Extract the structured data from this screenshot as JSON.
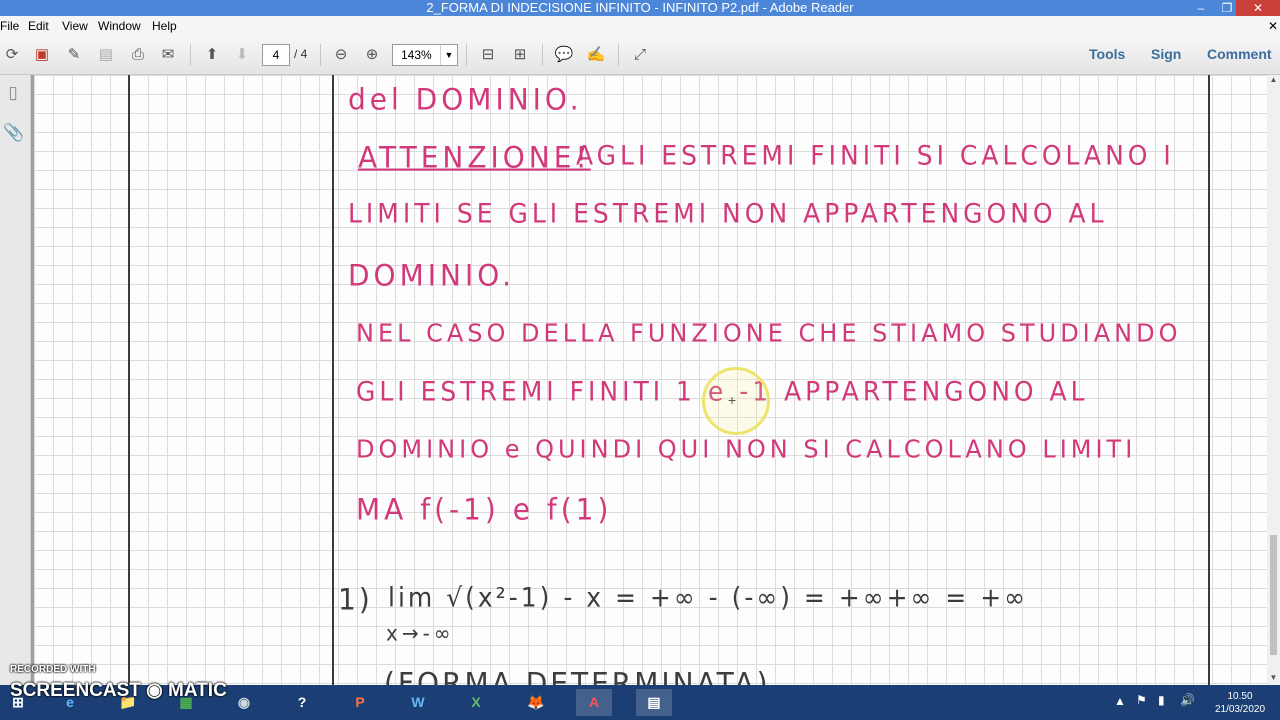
{
  "window": {
    "title": "2_FORMA DI INDECISIONE INFINITO - INFINITO P2.pdf - Adobe Reader",
    "minimize": "–",
    "restore": "❐",
    "close": "✕"
  },
  "menu": {
    "items": [
      "File",
      "Edit",
      "View",
      "Window",
      "Help"
    ],
    "close_doc": "✕"
  },
  "toolbar": {
    "page_current": "4",
    "page_total": "/ 4",
    "zoom": "143%",
    "tools_label": "Tools",
    "sign_label": "Sign",
    "comment_label": "Comment"
  },
  "document": {
    "lines": [
      "del DOMINIO.",
      "ATTENZIONE!",
      "AGLI ESTREMI FINITI SI CALCOLANO I",
      "LIMITI SE GLI ESTREMI NON APPARTENGONO AL",
      "DOMINIO.",
      "NEL CASO DELLA FUNZIONE CHE STIAMO STUDIANDO",
      "GLI ESTREMI FINITI  1 e -1  APPARTENGONO AL",
      "DOMINIO e QUINDI QUI NON SI CALCOLANO LIMITI",
      "MA  f(-1)  e  f(1)"
    ],
    "math": {
      "number": "1)",
      "expr": "lim  √(x²-1) - x  =  +∞ - (-∞) = +∞+∞ = +∞",
      "subscript": "x→-∞",
      "next_line": "(FORMA DETERMINATA)"
    }
  },
  "taskbar": {
    "apps": [
      "⊞",
      "e",
      "📁",
      "▦",
      "◉",
      "?",
      "P",
      "W",
      "X",
      "🦊",
      "A",
      "▤"
    ],
    "clock_time": "10.50",
    "clock_date": "21/03/2020"
  },
  "watermark": {
    "line1": "RECORDED WITH",
    "line2": "SCREENCAST ◉ MATIC"
  },
  "colors": {
    "ink_pink": "#d2397b",
    "ink_dark": "#3d3d3d",
    "titlebar": "#4b86d8",
    "taskbar": "#1b3f74"
  }
}
